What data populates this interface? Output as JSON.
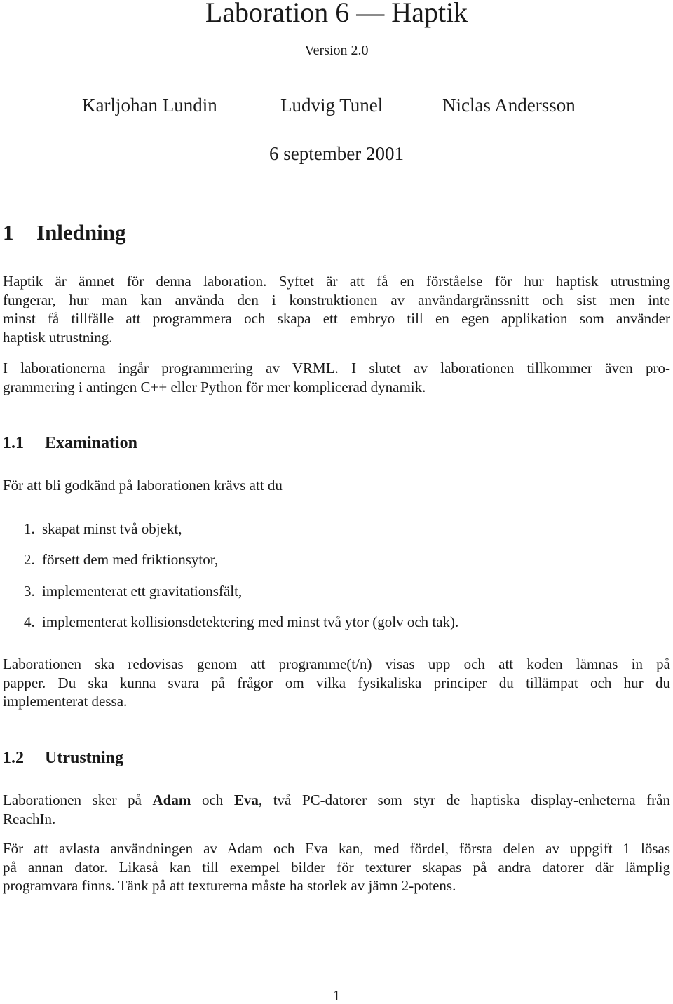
{
  "document": {
    "title": "Laboration 6 — Haptik",
    "version": "Version 2.0",
    "authors": [
      "Karljohan Lundin",
      "Ludvig Tunel",
      "Niclas Andersson"
    ],
    "date": "6 september 2001",
    "page_number": "1"
  },
  "sections": [
    {
      "number": "1",
      "title": "Inledning",
      "paragraphs": [
        {
          "lines": [
            "Haptik är ämnet för denna laboration. Syftet är att få en förståelse för hur haptisk utrustning",
            "fungerar, hur man kan använda den i konstruktionen av användargränssnitt och sist men inte",
            "minst få tillfälle att programmera och skapa ett embryo till en egen applikation som använder",
            "haptisk utrustning."
          ]
        },
        {
          "lines": [
            "I laborationerna ingår programmering av VRML. I slutet av laborationen tillkommer även pro-",
            "grammering i antingen C++ eller Python för mer komplicerad dynamik."
          ]
        }
      ]
    },
    {
      "number": "1.1",
      "title": "Examination",
      "intro": "För att bli godkänd på laborationen krävs att du",
      "list": [
        {
          "num": "1.",
          "text": "skapat minst två objekt,"
        },
        {
          "num": "2.",
          "text": "försett dem med friktionsytor,"
        },
        {
          "num": "3.",
          "text": "implementerat ett gravitationsfält,"
        },
        {
          "num": "4.",
          "text": "implementerat kollisionsdetektering med minst två ytor (golv och tak)."
        }
      ],
      "paragraph": {
        "lines": [
          "Laborationen ska redovisas genom att programme(t/n) visas upp och att koden lämnas in på",
          "papper. Du ska kunna svara på frågor om vilka fysikaliska principer du tillämpat och hur du",
          "implementerat dessa."
        ]
      }
    },
    {
      "number": "1.2",
      "title": "Utrustning",
      "paragraph1": {
        "line1_pre": "Laborationen sker på ",
        "line1_bold1": "Adam",
        "line1_mid": " och ",
        "line1_bold2": "Eva",
        "line1_post": ", två PC-datorer som styr de haptiska display-enheterna från",
        "line2": "ReachIn."
      },
      "paragraph2": {
        "lines": [
          "För att avlasta användningen av Adam och Eva kan, med fördel, första delen av uppgift 1 lösas",
          "på annan dator. Likaså kan till exempel bilder för texturer skapas på andra datorer där lämplig",
          "programvara finns. Tänk på att texturerna måste ha storlek av jämn 2-potens."
        ]
      }
    }
  ]
}
